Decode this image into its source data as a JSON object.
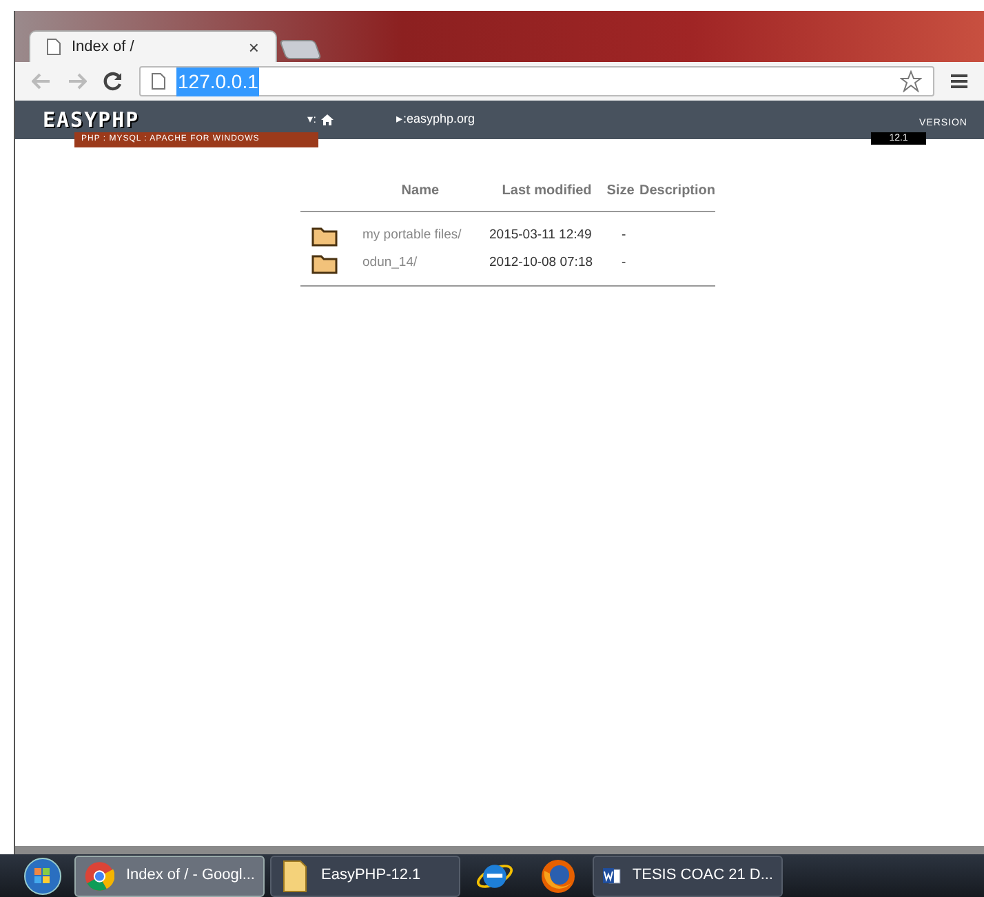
{
  "browser": {
    "tab_title": "Index of /",
    "tab_close": "×",
    "url": "127.0.0.1",
    "url_selected": true
  },
  "easyphp": {
    "logo": "EASYPHP",
    "tagline": "PHP : MYSQL : APACHE FOR WINDOWS",
    "nav": [
      {
        "kind": "home",
        "label": "▾:"
      },
      {
        "kind": "link",
        "label": "▸:easyphp.org"
      }
    ],
    "version_label": "VERSION",
    "version": "12.1"
  },
  "table": {
    "columns": [
      "Name",
      "Last modified",
      "Size",
      "Description"
    ],
    "rows": [
      {
        "name": "my portable files/",
        "modified": "2015-03-11 12:49",
        "size": "-"
      },
      {
        "name": "odun_14/",
        "modified": "2012-10-08 07:18",
        "size": "-"
      }
    ]
  },
  "taskbar": {
    "items": [
      {
        "kind": "chrome",
        "label": "Index of / - Googl...",
        "selected": true
      },
      {
        "kind": "folder",
        "label": "EasyPHP-12.1",
        "selected": false
      },
      {
        "kind": "ie",
        "selected": false
      },
      {
        "kind": "firefox",
        "selected": false
      },
      {
        "kind": "word",
        "label": "TESIS COAC 21 D...",
        "selected": false
      }
    ]
  }
}
